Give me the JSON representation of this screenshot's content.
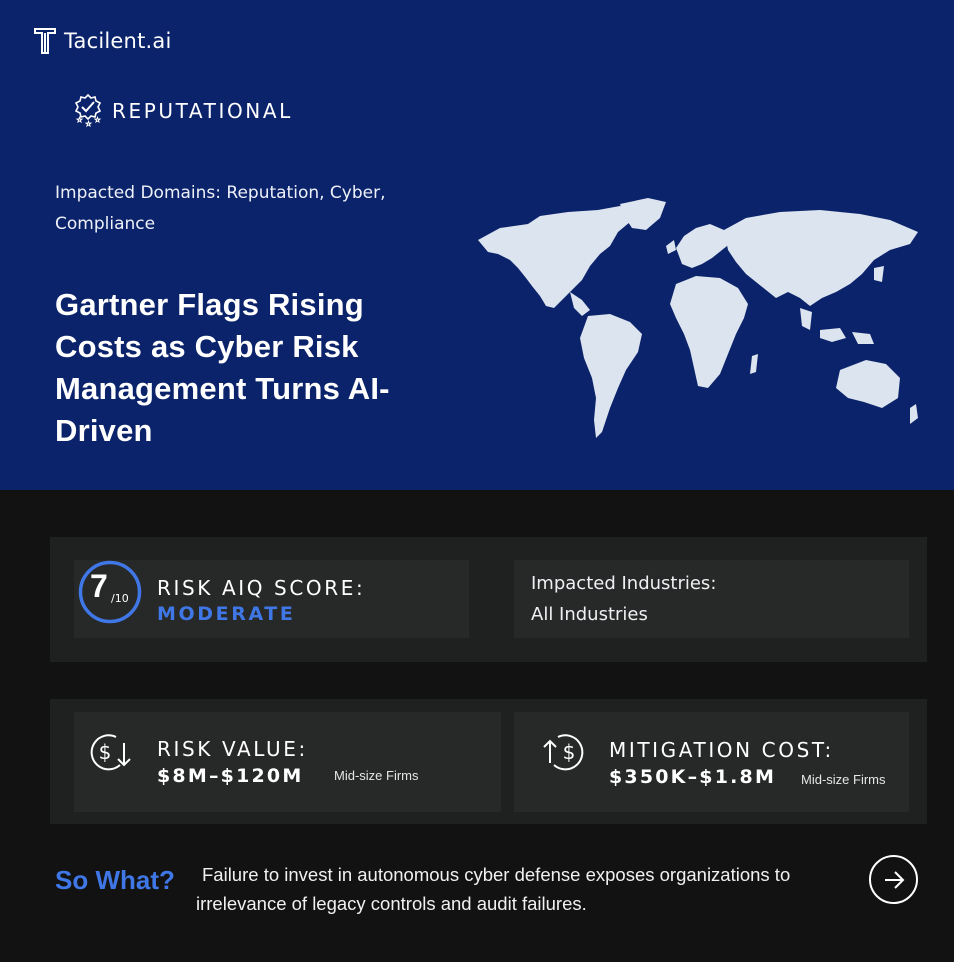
{
  "brand": {
    "name": "Tacilent.ai"
  },
  "category": {
    "label": "REPUTATIONAL",
    "icon": "check-badge-stars-icon"
  },
  "domains": {
    "text": "Impacted Domains: Reputation, Cyber, Compliance"
  },
  "headline": {
    "text": "Gartner Flags Rising Costs as Cyber Risk Management Turns AI-Driven"
  },
  "score": {
    "value": "7",
    "denominator": "/10",
    "label": "RISK AIQ SCORE:",
    "level": "MODERATE"
  },
  "industries": {
    "label": "Impacted Industries:",
    "value": "All Industries"
  },
  "risk_value": {
    "label": "RISK VALUE:",
    "value": "$8M–$120M",
    "note": "Mid-size Firms",
    "icon": "dollar-down-icon"
  },
  "mitigation_cost": {
    "label": "MITIGATION COST:",
    "value": "$350K–$1.8M",
    "note": "Mid-size Firms",
    "icon": "dollar-up-icon"
  },
  "so_what": {
    "heading": "So What?",
    "body": "Failure to invest in autonomous cyber defense exposes organizations to irrelevance of legacy controls and audit failures."
  },
  "colors": {
    "hero_bg": "#0b236a",
    "accent": "#3f78e6",
    "page_bg": "#121212",
    "panel_bg": "#1f2020",
    "card_bg": "#272828"
  }
}
